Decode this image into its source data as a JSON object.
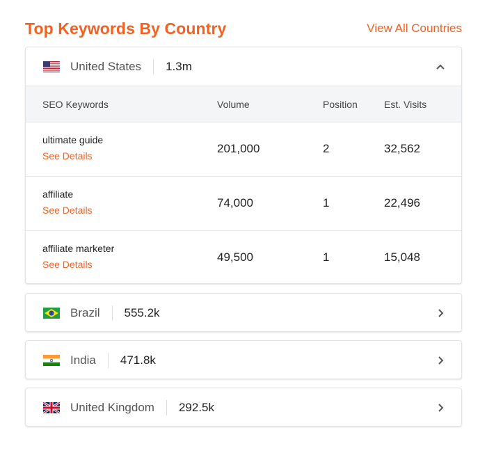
{
  "header": {
    "title": "Top Keywords By Country",
    "view_all": "View All Countries"
  },
  "countries": [
    {
      "name": "United States",
      "value": "1.3m",
      "expanded": true,
      "flag": "us-flag-icon"
    },
    {
      "name": "Brazil",
      "value": "555.2k",
      "expanded": false,
      "flag": "brazil-flag-icon"
    },
    {
      "name": "India",
      "value": "471.8k",
      "expanded": false,
      "flag": "india-flag-icon"
    },
    {
      "name": "United Kingdom",
      "value": "292.5k",
      "expanded": false,
      "flag": "uk-flag-icon"
    }
  ],
  "table": {
    "headers": [
      "SEO Keywords",
      "Volume",
      "Position",
      "Est. Visits"
    ],
    "rows": [
      {
        "keyword": "ultimate guide",
        "details": "See Details",
        "volume": "201,000",
        "position": "2",
        "visits": "32,562"
      },
      {
        "keyword": "affiliate",
        "details": "See Details",
        "volume": "74,000",
        "position": "1",
        "visits": "22,496"
      },
      {
        "keyword": "affiliate marketer",
        "details": "See Details",
        "volume": "49,500",
        "position": "1",
        "visits": "15,048"
      }
    ]
  },
  "colors": {
    "accent": "#f26122",
    "border": "#e3e3e3",
    "table_header_bg": "#f4f5f7"
  }
}
